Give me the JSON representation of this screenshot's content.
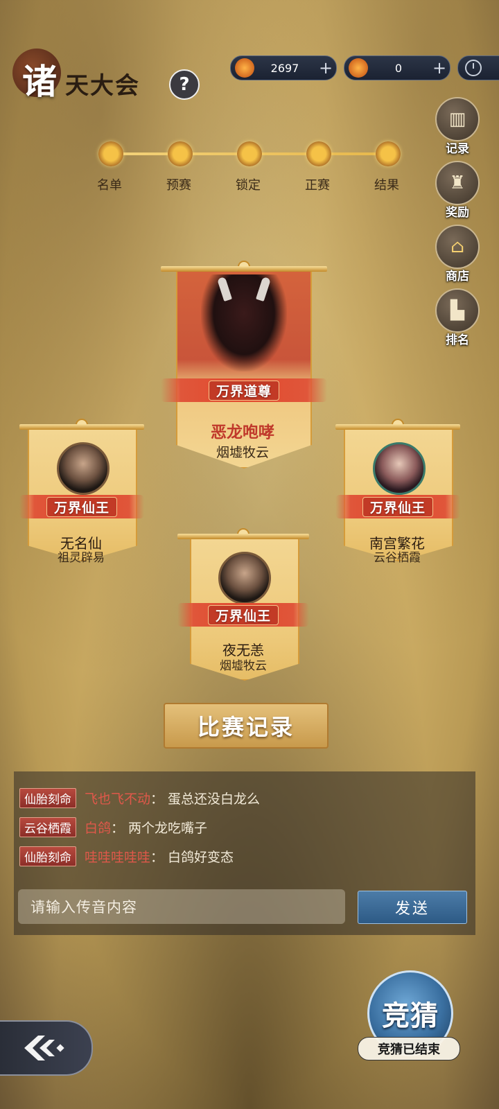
{
  "header": {
    "title_first": "诸",
    "title_rest": "天大会",
    "help_label": "?"
  },
  "currencies": [
    {
      "value": "2697",
      "plus": "+"
    },
    {
      "value": "0",
      "plus": "+"
    }
  ],
  "progress": {
    "steps": [
      "名单",
      "预赛",
      "锁定",
      "正赛",
      "结果"
    ]
  },
  "side_menu": [
    {
      "label": "记录",
      "icon": "record-icon"
    },
    {
      "label": "奖励",
      "icon": "reward-bag-icon"
    },
    {
      "label": "商店",
      "icon": "shop-pavilion-icon"
    },
    {
      "label": "排名",
      "icon": "ranking-icon"
    }
  ],
  "champion": {
    "title": "万界道尊",
    "name": "恶龙咆哮",
    "guild": "烟墟牧云"
  },
  "left_player": {
    "title": "万界仙王",
    "name": "无名仙",
    "guild": "祖灵辟易"
  },
  "right_player": {
    "title": "万界仙王",
    "name": "南宫繁花",
    "guild": "云谷栖霞"
  },
  "bottom_player": {
    "title": "万界仙王",
    "name": "夜无恙",
    "guild": "烟墟牧云"
  },
  "record_button": "比赛记录",
  "chat": {
    "messages": [
      {
        "tag": "仙胎刻命",
        "user": "飞也飞不动",
        "colon": "：",
        "text": "蛋总还没白龙么"
      },
      {
        "tag": "云谷栖霞",
        "user": "白鸽",
        "colon": "：",
        "text": "两个龙吃嘴子"
      },
      {
        "tag": "仙胎刻命",
        "user": "哇哇哇哇哇",
        "colon": "：",
        "text": "白鸽好变态"
      }
    ],
    "input_placeholder": "请输入传音内容",
    "send_label": "发送"
  },
  "guess": {
    "label": "竞猜",
    "status": "竞猜已结束"
  },
  "colors": {
    "accent_gold": "#e7b84b",
    "ribbon_red": "#e24a2e",
    "send_blue": "#2d5a85",
    "username_red": "#e0584a"
  }
}
